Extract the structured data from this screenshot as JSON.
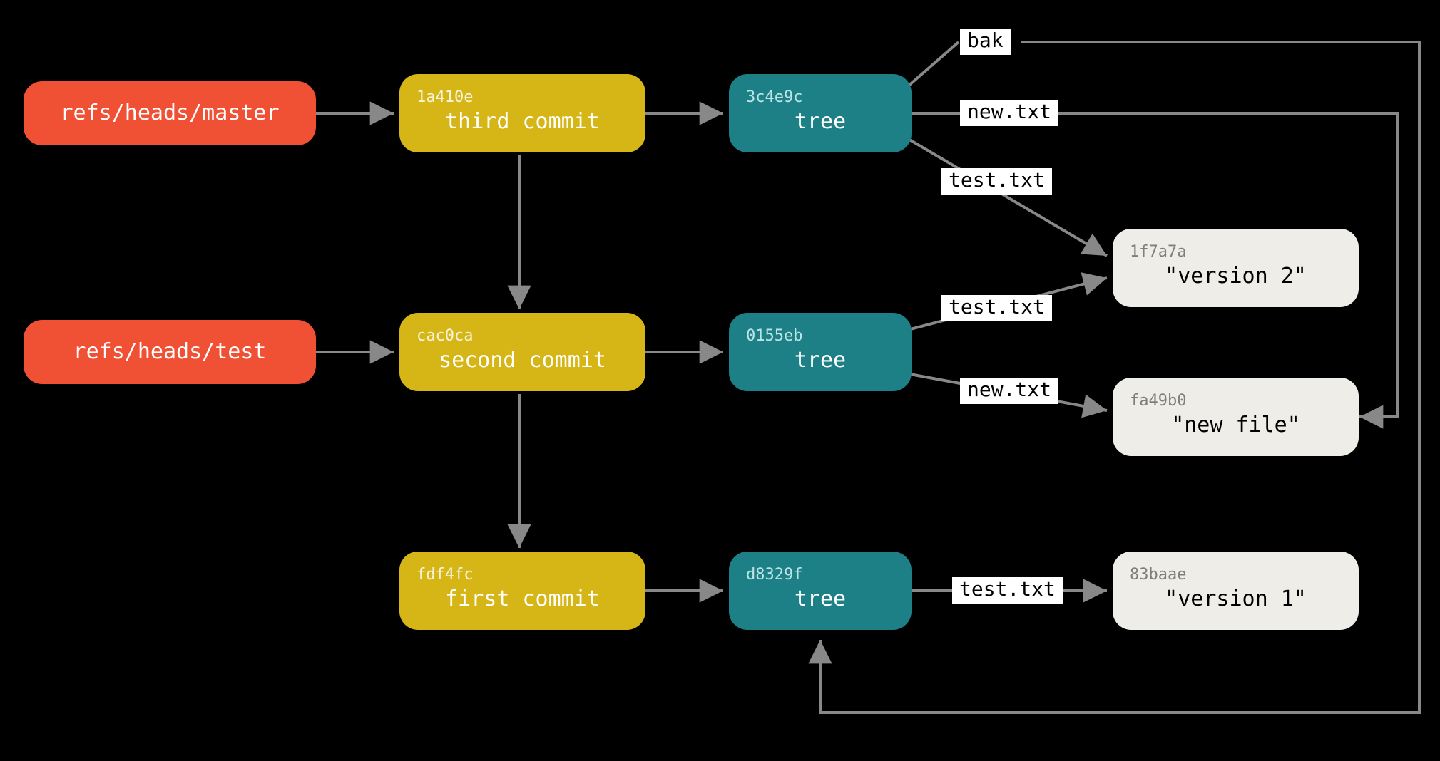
{
  "refs": {
    "master": {
      "label": "refs/heads/master"
    },
    "test": {
      "label": "refs/heads/test"
    }
  },
  "commits": {
    "third": {
      "hash": "1a410e",
      "label": "third commit"
    },
    "second": {
      "hash": "cac0ca",
      "label": "second commit"
    },
    "first": {
      "hash": "fdf4fc",
      "label": "first commit"
    }
  },
  "trees": {
    "t3": {
      "hash": "3c4e9c",
      "label": "tree"
    },
    "t2": {
      "hash": "0155eb",
      "label": "tree"
    },
    "t1": {
      "hash": "d8329f",
      "label": "tree"
    }
  },
  "blobs": {
    "v2": {
      "hash": "1f7a7a",
      "label": "\"version 2\""
    },
    "nf": {
      "hash": "fa49b0",
      "label": "\"new file\""
    },
    "v1": {
      "hash": "83baae",
      "label": "\"version 1\""
    }
  },
  "edge_labels": {
    "bak": "bak",
    "newtxt_t3": "new.txt",
    "testtxt_t3": "test.txt",
    "testtxt_t2": "test.txt",
    "newtxt_t2": "new.txt",
    "testtxt_t1": "test.txt"
  },
  "colors": {
    "ref": "#f05033",
    "commit": "#d6b616",
    "tree": "#1e8087",
    "blob": "#eeede8",
    "arrow": "#888888"
  }
}
